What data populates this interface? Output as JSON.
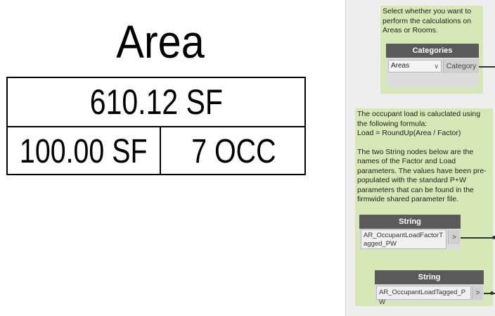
{
  "area_tag": {
    "title": "Area",
    "area_value": "610.12 SF",
    "factor_value": "100.00 SF",
    "occupancy_value": "7 OCC"
  },
  "dynamo": {
    "category_group": {
      "note": "Select whether you want to perform the calculations on Areas or Rooms.",
      "node_title": "Categories",
      "dropdown_value": "Areas",
      "output_port": "Category"
    },
    "string_group": {
      "note_line1": "The occupant load is caluclated using the following formula:",
      "note_formula": "Load = RoundUp(Area / Factor)",
      "note_para2": "The two String nodes below are the names of the Factor and Load parameters. The values have been pre-populated with the standard P+W parameters that can be found in the firmwide shared parameter file.",
      "string_node_1": {
        "title": "String",
        "value": "AR_OccupantLoadFactorTagged_PW",
        "output_port": ">"
      },
      "string_node_2": {
        "title": "String",
        "value": "AR_OccupantLoadTagged_PW",
        "output_port": ">"
      }
    }
  }
}
